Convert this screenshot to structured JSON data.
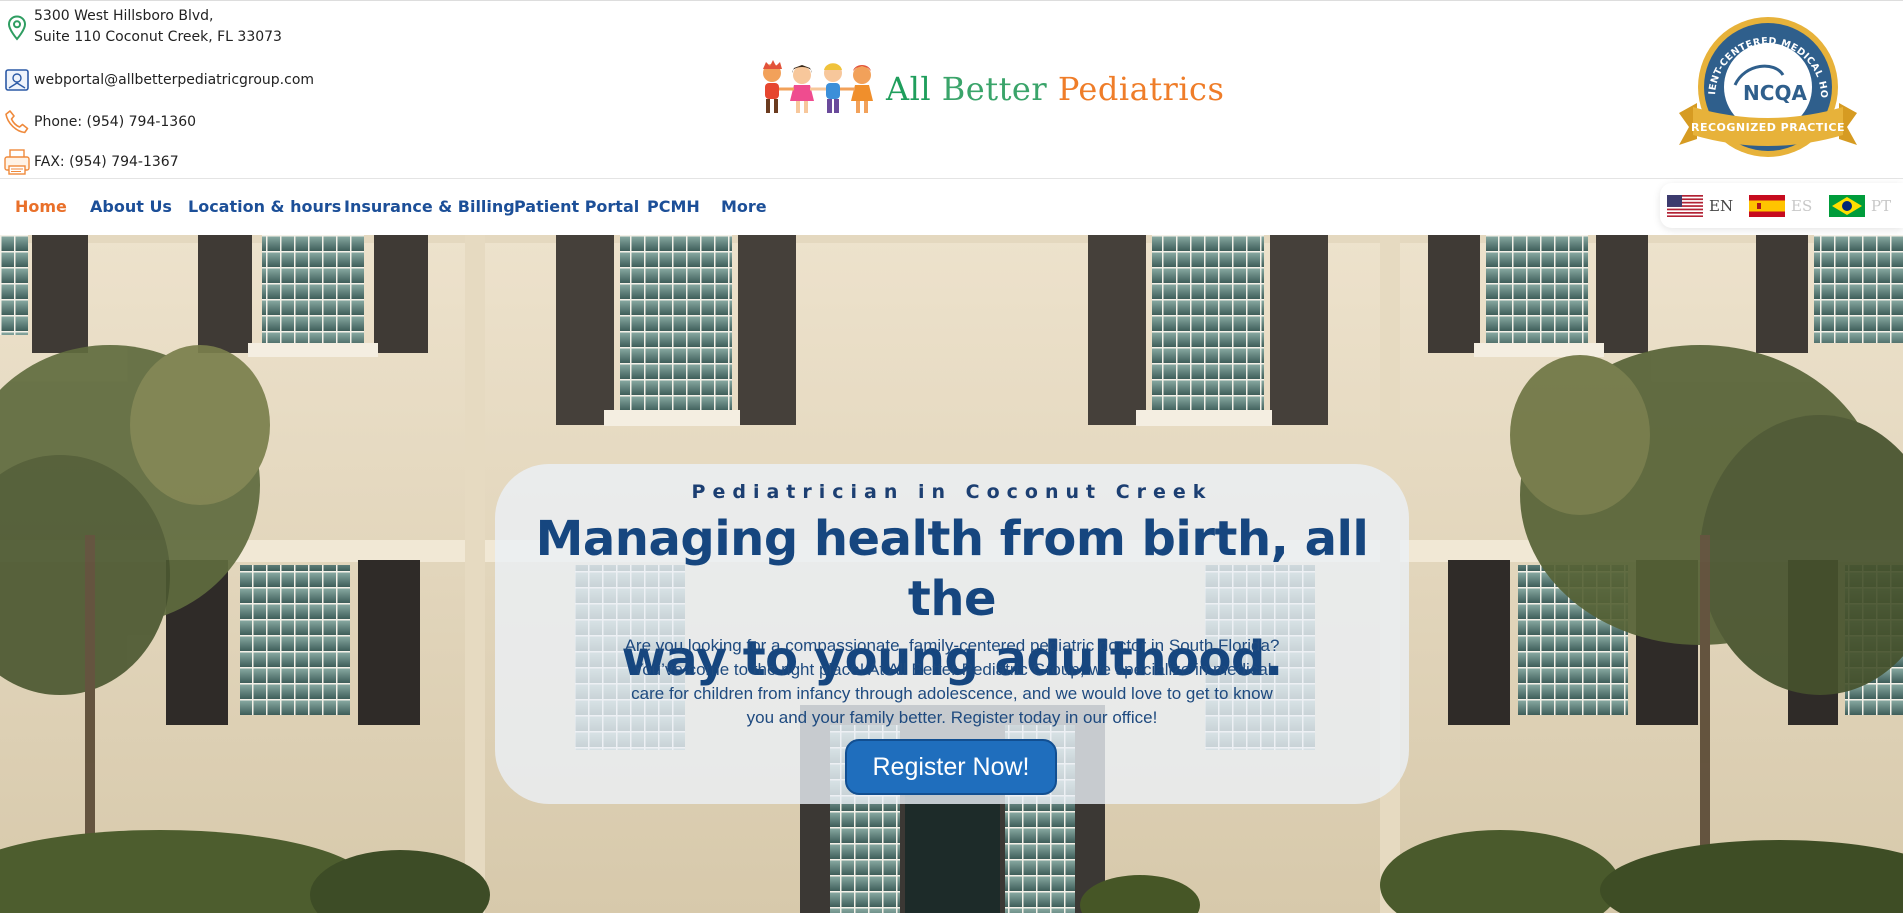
{
  "contact": {
    "address_line1": "5300 West Hillsboro Blvd,",
    "address_line2": "Suite 110 Coconut Creek, FL 33073",
    "email": "webportal@allbetterpediatricgroup.com",
    "phone": "Phone: (954) 794-1360",
    "fax": "FAX: (954) 794-1367"
  },
  "logo": {
    "word1": "All",
    "word2": "Better",
    "word3": "Pediatrics"
  },
  "badge": {
    "arc_text": "PATIENT-CENTERED MEDICAL HOME",
    "center_text": "NCQA",
    "ribbon_text": "RECOGNIZED PRACTICE"
  },
  "nav": {
    "items": [
      {
        "label": "Home"
      },
      {
        "label": "About Us"
      },
      {
        "label": "Location & hours"
      },
      {
        "label": "Insurance & Billing"
      },
      {
        "label": "Patient Portal"
      },
      {
        "label": "PCMH"
      },
      {
        "label": "More"
      }
    ],
    "active_index": 0
  },
  "languages": [
    {
      "code": "EN",
      "flag": "us-flag"
    },
    {
      "code": "ES",
      "flag": "spain-flag"
    },
    {
      "code": "PT",
      "flag": "brazil-flag"
    }
  ],
  "hero": {
    "eyebrow": "Pediatrician in Coconut Creek",
    "headline_line1": "Managing health from birth, all the",
    "headline_line2": "way to young adulthood.",
    "body": "Are you looking for a compassionate, family-centered pediatric doctor in South Florida? You’ve come to the right place! At All Better Pediatric Group, we specialize in medical care for children from infancy through adolescence, and we would love to get to know you and your family better. Register today in our office!",
    "cta": "Register Now!"
  },
  "colors": {
    "nav_text": "#1c4f98",
    "nav_active": "#e9702a",
    "headline": "#16467f",
    "button": "#1f6ebd"
  }
}
